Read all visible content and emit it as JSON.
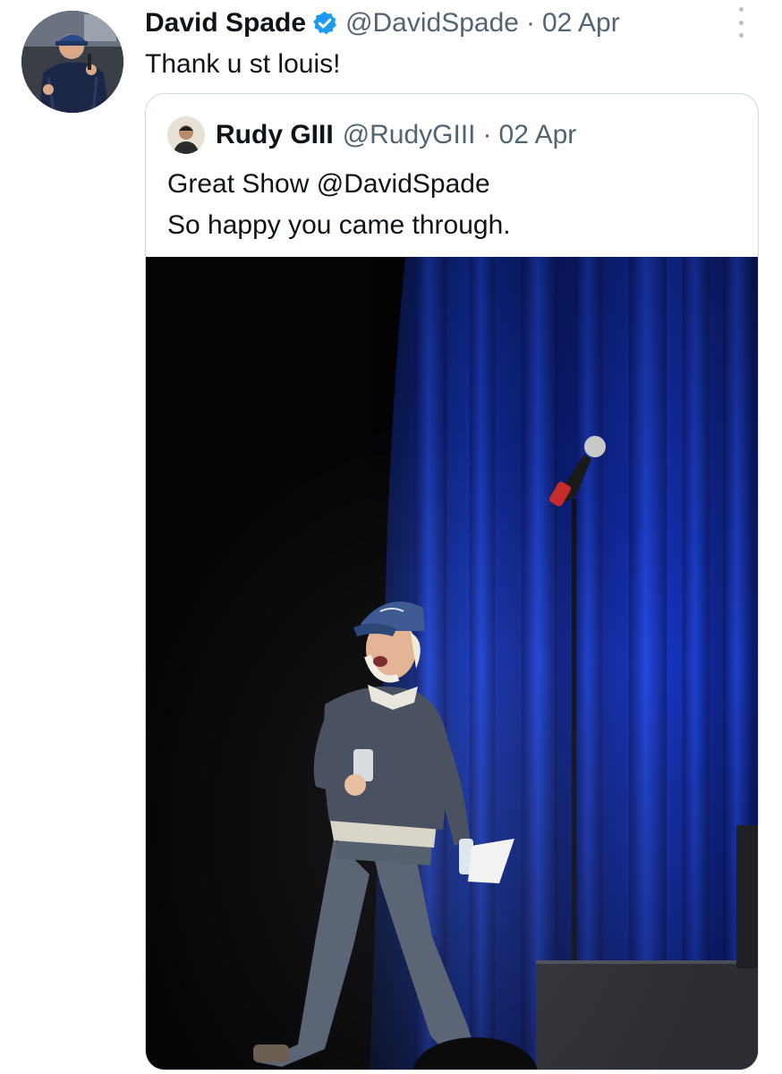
{
  "tweet": {
    "author_name": "David Spade",
    "author_handle": "@DavidSpade",
    "separator": "·",
    "date": "02 Apr",
    "text": "Thank u st louis!",
    "more_icon": "more-vertical-icon",
    "verified_icon": "verified-badge-icon"
  },
  "quoted_tweet": {
    "author_name": "Rudy GIII",
    "author_handle": "@RudyGIII",
    "separator": "·",
    "date": "02 Apr",
    "text_lines": [
      "Great Show @DavidSpade",
      "So happy you came through."
    ]
  },
  "colors": {
    "verified_blue": "#1d9bf0",
    "secondary_text": "#536471",
    "curtain_blue": "#1a3fd0"
  }
}
